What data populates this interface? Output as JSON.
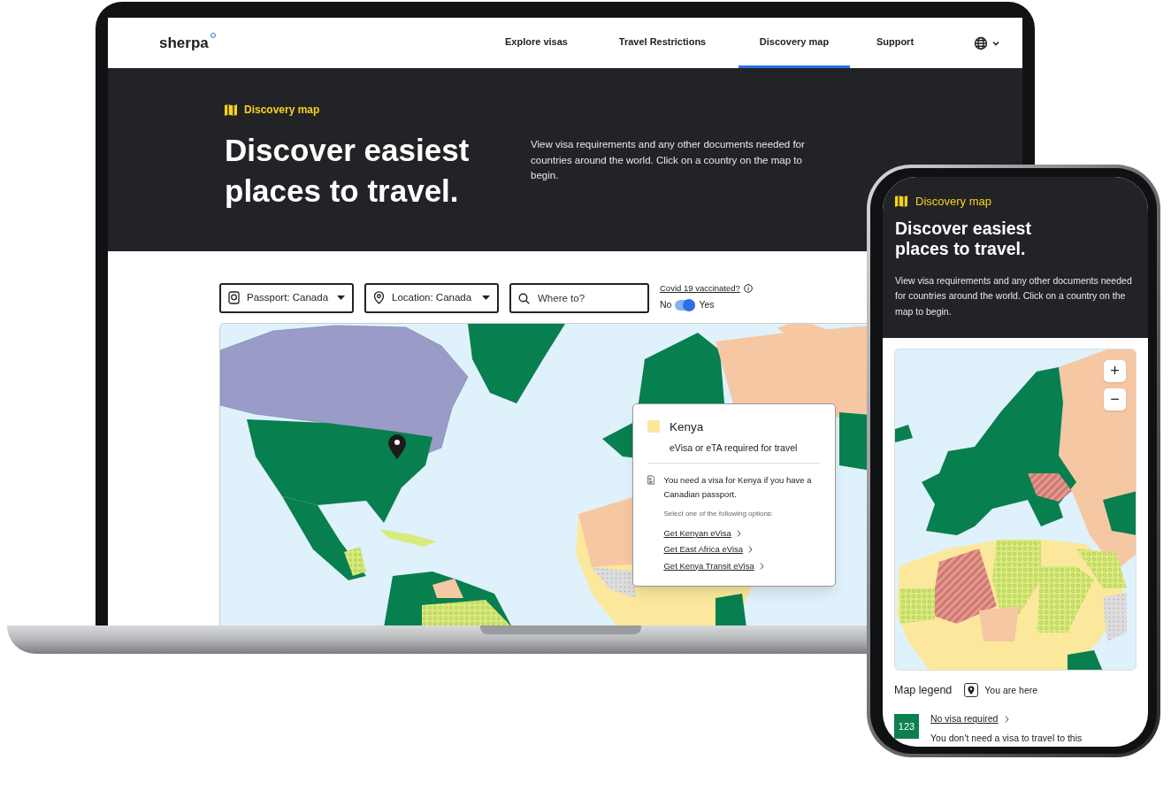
{
  "laptop": {
    "nav": {
      "logo": "sherpa",
      "items": [
        {
          "label": "Explore visas",
          "selected": false
        },
        {
          "label": "Travel Restrictions",
          "selected": false
        },
        {
          "label": "Discovery map",
          "selected": true
        },
        {
          "label": "Support",
          "selected": false
        }
      ]
    },
    "hero": {
      "eyebrow": "Discovery map",
      "title": "Discover easiest places to travel.",
      "description": "View visa requirements and any other documents needed for countries around the world. Click on a country on the map to begin."
    },
    "filters": {
      "passport": "Passport: Canada",
      "location": "Location: Canada",
      "search_placeholder": "Where to?",
      "vaccinated": {
        "label": "Covid 19 vaccinated?",
        "off_label": "No",
        "on_label": "Yes",
        "on": true
      }
    },
    "popup": {
      "country": "Kenya",
      "color": "#fbe89c",
      "status": "eVisa or eTA required for travel",
      "message": "You need a visa for Kenya if you have a Canadian passport.",
      "options_heading": "Select one of the following options:",
      "options": [
        "Get Kenyan eVisa",
        "Get East Africa eVisa",
        "Get Kenya Transit eVisa"
      ]
    }
  },
  "phone": {
    "hero": {
      "eyebrow": "Discovery map",
      "title": "Discover easiest places to travel.",
      "description": "View visa requirements and any other documents needed for countries around the world. Click on a country on the map to begin."
    },
    "zoom": {
      "in": "+",
      "out": "−"
    },
    "legend": {
      "title": "Map legend",
      "you_are_here": "You are here",
      "items": [
        {
          "badge": "123",
          "label": "No visa required",
          "description": "You don’t need a visa to travel to this",
          "color": "#0b7f4f"
        }
      ]
    }
  }
}
